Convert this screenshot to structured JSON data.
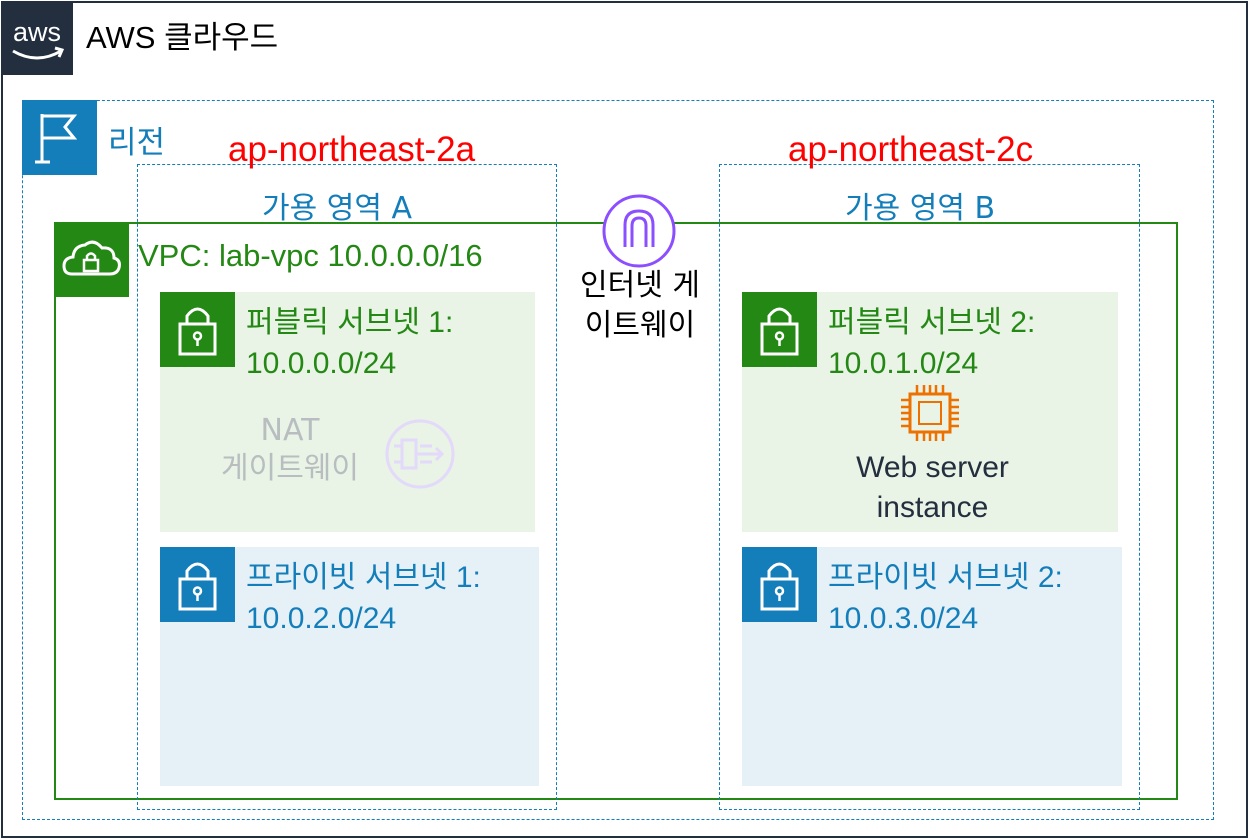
{
  "cloud": {
    "title": "AWS 클라우드",
    "logo_text": "aws"
  },
  "region": {
    "label": "리전"
  },
  "availability_zones": [
    {
      "name": "ap-northeast-2a",
      "label": "가용 영역 A"
    },
    {
      "name": "ap-northeast-2c",
      "label": "가용 영역 B"
    }
  ],
  "vpc": {
    "label": "VPC:  lab-vpc  10.0.0.0/16"
  },
  "internet_gateway": {
    "line1": "인터넷 게",
    "line2": "이트웨이"
  },
  "subnets": {
    "public1": {
      "name": "퍼블릭 서브넷 1:",
      "cidr": "10.0.0.0/24"
    },
    "public2": {
      "name": "퍼블릭 서브넷 2:",
      "cidr": "10.0.1.0/24"
    },
    "private1": {
      "name": "프라이빗 서브넷 1:",
      "cidr": "10.0.2.0/24"
    },
    "private2": {
      "name": "프라이빗 서브넷 2:",
      "cidr": "10.0.3.0/24"
    }
  },
  "nat_gateway": {
    "line1": "NAT",
    "line2": "게이트웨이"
  },
  "web_server": {
    "line1": "Web server",
    "line2": "instance"
  },
  "colors": {
    "aws_dark": "#232f3e",
    "region_blue": "#147eba",
    "vpc_green": "#248814",
    "az_name_red": "#ff0000",
    "public_bg": "#e9f3e6",
    "private_bg": "#e6f1f7",
    "igw_purple": "#8c4fff",
    "ec2_orange": "#ed7100"
  },
  "icons": [
    "aws-logo-icon",
    "region-flag-icon",
    "vpc-cloud-lock-icon",
    "internet-gateway-icon",
    "subnet-lock-icon",
    "nat-gateway-icon",
    "ec2-chip-icon"
  ]
}
